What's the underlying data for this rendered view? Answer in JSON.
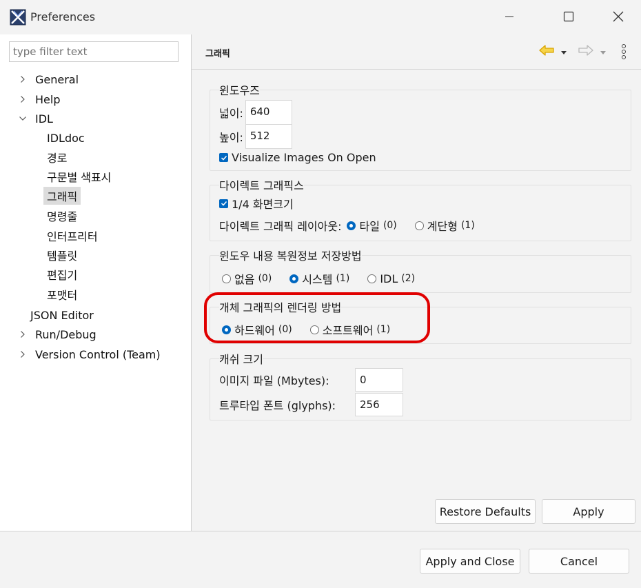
{
  "window": {
    "title": "Preferences"
  },
  "sidebar": {
    "filter_placeholder": "type filter text",
    "items": [
      {
        "label": "General",
        "level": 0,
        "expandable": true,
        "expanded": false
      },
      {
        "label": "Help",
        "level": 0,
        "expandable": true,
        "expanded": false
      },
      {
        "label": "IDL",
        "level": 0,
        "expandable": true,
        "expanded": true
      },
      {
        "label": "IDLdoc",
        "level": 1
      },
      {
        "label": "경로",
        "level": 1
      },
      {
        "label": "구문별 색표시",
        "level": 1
      },
      {
        "label": "그래픽",
        "level": 1,
        "selected": true
      },
      {
        "label": "명령줄",
        "level": 1
      },
      {
        "label": "인터프리터",
        "level": 1
      },
      {
        "label": "템플릿",
        "level": 1
      },
      {
        "label": "편집기",
        "level": 1
      },
      {
        "label": "포맷터",
        "level": 1
      },
      {
        "label": "JSON Editor",
        "level": 0,
        "expandable": false
      },
      {
        "label": "Run/Debug",
        "level": 0,
        "expandable": true,
        "expanded": false
      },
      {
        "label": "Version Control (Team)",
        "level": 0,
        "expandable": true,
        "expanded": false
      }
    ]
  },
  "page": {
    "title": "그래픽",
    "windows": {
      "title": "윈도우즈",
      "width_label": "넓이:",
      "width_value": "640",
      "height_label": "높이:",
      "height_value": "512",
      "visualize_label": "Visualize Images On Open",
      "visualize_checked": true
    },
    "direct": {
      "title": "다이렉트 그래픽스",
      "quarter_label": "1/4 화면크기",
      "quarter_checked": true,
      "layout_label": "다이렉트 그래픽 레이아웃:",
      "opt_tile": "타일",
      "opt_tile_num": "(0)",
      "opt_cascade": "계단형",
      "opt_cascade_num": "(1)"
    },
    "backing": {
      "title": "윈도우 내용 복원정보 저장방법",
      "opt_none": "없음",
      "opt_none_num": "(0)",
      "opt_system": "시스템",
      "opt_system_num": "(1)",
      "opt_idl": "IDL",
      "opt_idl_num": "(2)"
    },
    "rendering": {
      "title": "개체 그래픽의 렌더링 방법",
      "opt_hw": "하드웨어",
      "opt_hw_num": "(0)",
      "opt_sw": "소프트웨어",
      "opt_sw_num": "(1)"
    },
    "cache": {
      "title": "캐쉬 크기",
      "image_label": "이미지 파일 (Mbytes):",
      "image_value": "0",
      "font_label": "트루타입 폰트 (glyphs):",
      "font_value": "256"
    },
    "restore_defaults": "Restore Defaults",
    "apply": "Apply"
  },
  "footer": {
    "apply_close": "Apply and Close",
    "cancel": "Cancel"
  },
  "colors": {
    "accent": "#0067c0",
    "highlight_annotation": "#e00000",
    "selection_bg": "#dcdcdc",
    "nav_arrow": "#d9a400"
  }
}
